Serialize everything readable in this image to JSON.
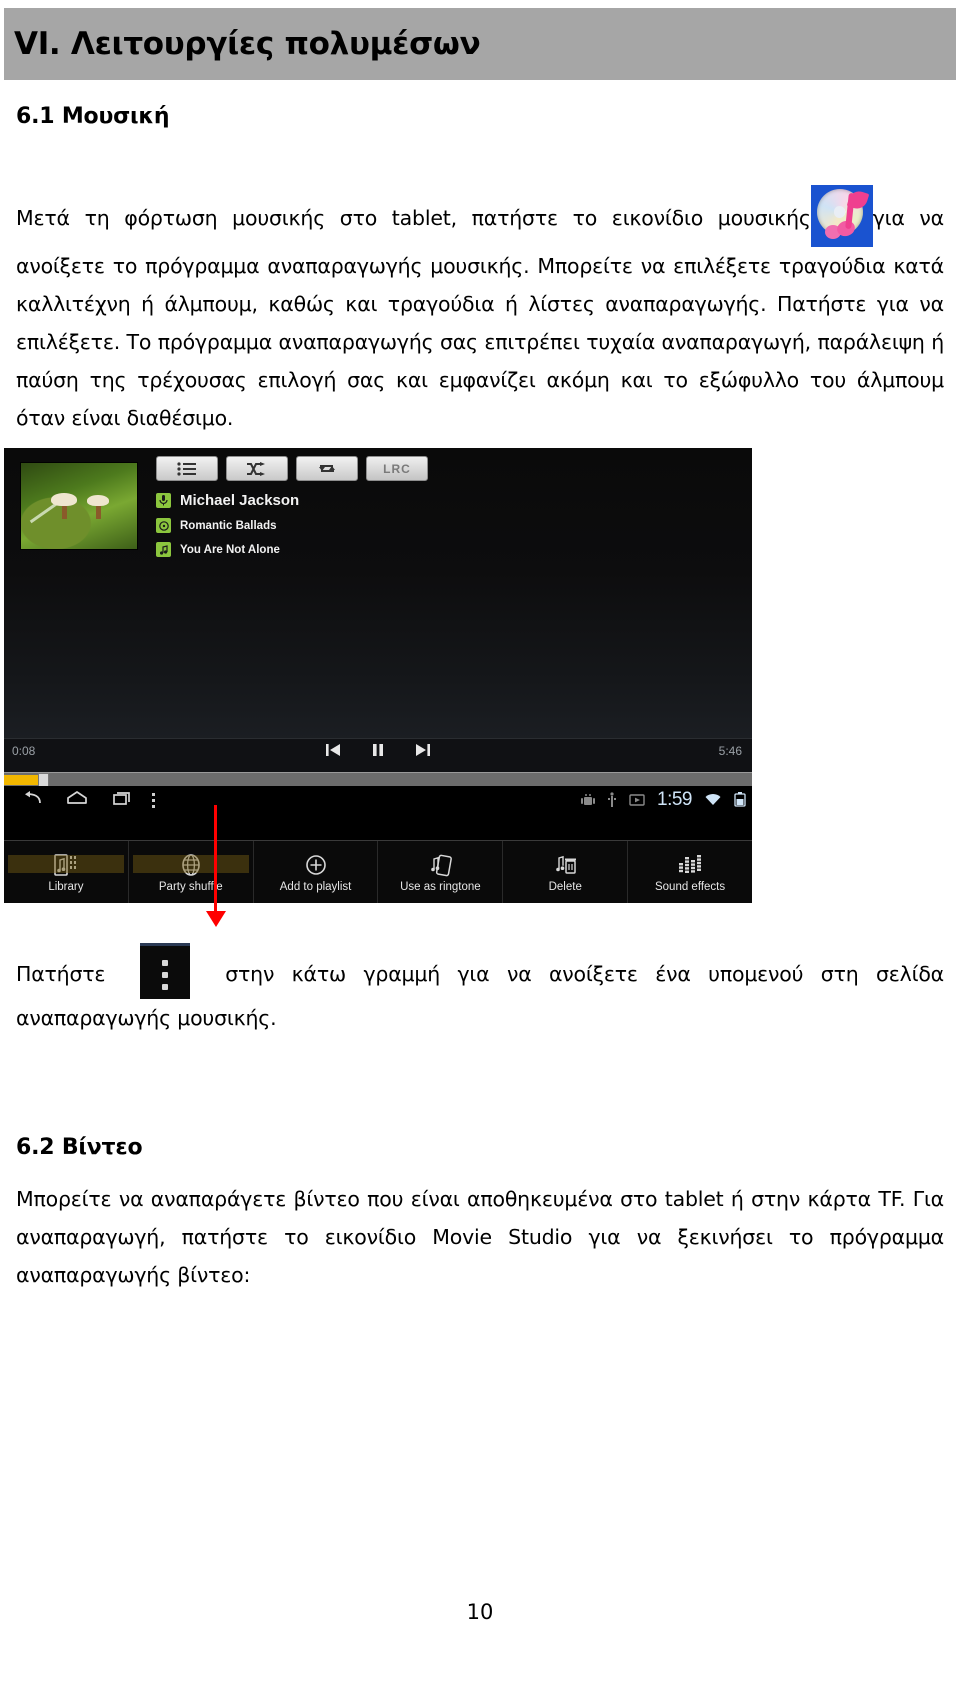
{
  "header": {
    "title": "VI. Λειτουργίες πολυμέσων"
  },
  "sections": {
    "music_heading": "6.1 Μουσική",
    "video_heading": "6.2 Βίντεο"
  },
  "paragraphs": {
    "p1_before_icon": "Μετά τη φόρτωση μουσικής στο tablet, πατήστε το εικονίδιο μουσικής",
    "p1_after_icon": "για να ανοίξετε το πρόγραμμα αναπαραγωγής μουσικής.  Μπορείτε να επιλέξετε τραγούδια κατά καλλιτέχνη ή άλμπουμ, καθώς και τραγούδια ή λίστες αναπαραγωγής. Πατήστε για να επιλέξετε. Το πρόγραμμα αναπαραγωγής σας επιτρέπει τυχαία αναπαραγωγή, παράλειψη ή παύση της τρέχουσας επιλογή σας και εμφανίζει ακόμη και το εξώφυλλο του άλμπουμ όταν είναι διαθέσιμο.",
    "p2_before_icon": "Πατήστε",
    "p2_after_icon": "στην κάτω γραμμή για να ανοίξετε ένα υπομενού στη σελίδα αναπαραγωγής μουσικής.",
    "p3": "Μπορείτε να αναπαράγετε βίντεο που είναι αποθηκευμένα στο tablet ή στην κάρτα TF. Για αναπαραγωγή, πατήστε το εικονίδιο Movie Studio για να ξεκινήσει το πρόγραμμα αναπαραγωγής βίντεο:"
  },
  "icons": {
    "music_app": "music-cd-note-icon",
    "overflow_menu": "three-dot-menu-icon"
  },
  "screenshot": {
    "player": {
      "album_art_alt": "album-cover-moss-mushrooms",
      "toolbar_buttons": [
        {
          "name": "playlist-button",
          "label": ""
        },
        {
          "name": "shuffle-button",
          "label": ""
        },
        {
          "name": "repeat-button",
          "label": ""
        },
        {
          "name": "lrc-button",
          "label": "LRC"
        }
      ],
      "artist": "Michael Jackson",
      "album": "Romantic Ballads",
      "track": "You Are Not Alone",
      "elapsed_time": "0:08",
      "total_time": "5:46",
      "transport": [
        {
          "name": "previous-button"
        },
        {
          "name": "pause-button"
        },
        {
          "name": "next-button"
        }
      ]
    },
    "navbar": {
      "back": "back-icon",
      "home": "home-icon",
      "recents": "recents-icon",
      "overflow": "overflow-menu-icon",
      "status_icons": [
        "android-icon",
        "usb-icon",
        "screenshot-icon"
      ],
      "clock": "1:59",
      "wifi": "wifi-icon",
      "battery": "battery-icon"
    },
    "options_menu": [
      {
        "icon": "library-icon",
        "label": "Library"
      },
      {
        "icon": "party-shuffle-icon",
        "label": "Party shuffle"
      },
      {
        "icon": "add-to-playlist-icon",
        "label": "Add to playlist"
      },
      {
        "icon": "use-as-ringtone-icon",
        "label": "Use as ringtone"
      },
      {
        "icon": "delete-icon",
        "label": "Delete"
      },
      {
        "icon": "sound-effects-icon",
        "label": "Sound effects"
      }
    ]
  },
  "footer": {
    "page_number": "10"
  },
  "colors": {
    "banner_gray": "#a6a6a6",
    "annotation_red": "#ff0000",
    "accent_green": "#8cc63e",
    "progress_amber": "#f2b700"
  }
}
